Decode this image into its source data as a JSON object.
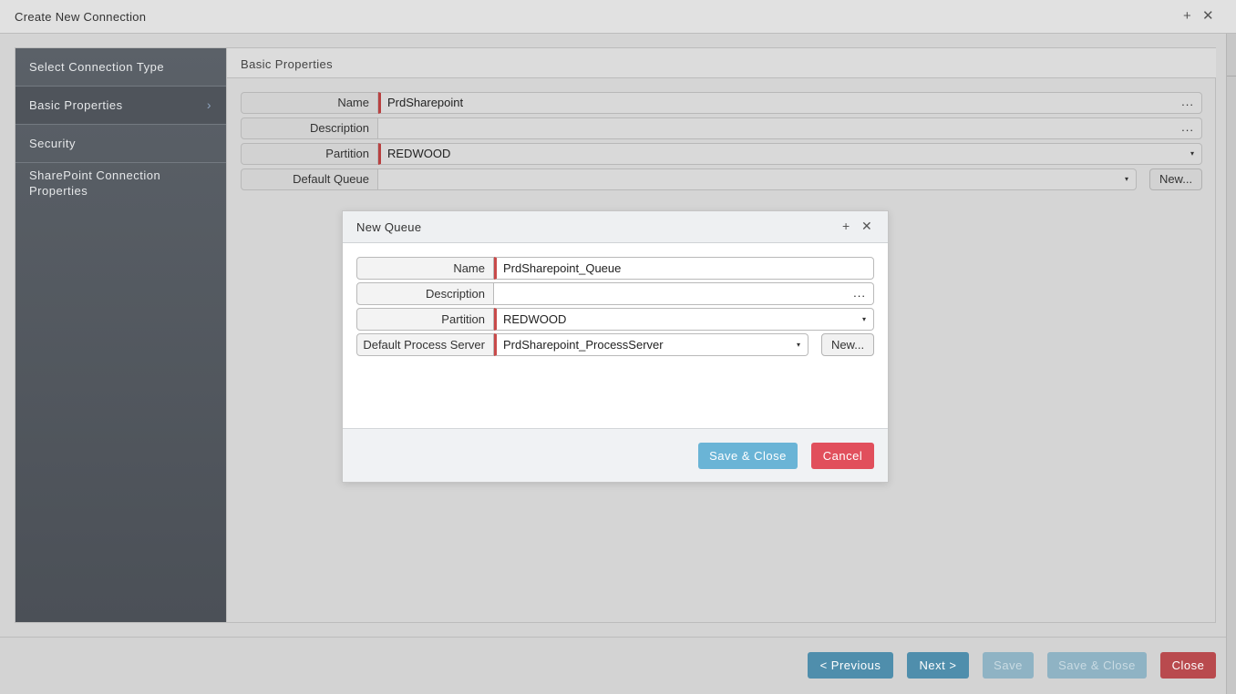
{
  "window": {
    "title": "Create New Connection",
    "maximize_glyph": "+",
    "close_glyph": "✕"
  },
  "sidebar": {
    "items": [
      {
        "label": "Select Connection Type"
      },
      {
        "label": "Basic Properties",
        "active": true,
        "chevron": "›"
      },
      {
        "label": "Security"
      },
      {
        "label": "SharePoint Connection Properties"
      }
    ]
  },
  "content": {
    "title": "Basic Properties",
    "fields": {
      "name": {
        "label": "Name",
        "value": "PrdSharepoint",
        "more": "..."
      },
      "description": {
        "label": "Description",
        "value": "",
        "more": "..."
      },
      "partition": {
        "label": "Partition",
        "value": "REDWOOD",
        "caret": "▾"
      },
      "default_queue": {
        "label": "Default Queue",
        "value": "",
        "caret": "▾",
        "new_label": "New..."
      }
    }
  },
  "footer": {
    "previous": "< Previous",
    "next": "Next >",
    "save": "Save",
    "save_close": "Save & Close",
    "close": "Close"
  },
  "modal": {
    "title": "New Queue",
    "maximize_glyph": "+",
    "close_glyph": "✕",
    "fields": {
      "name": {
        "label": "Name",
        "value": "PrdSharepoint_Queue"
      },
      "description": {
        "label": "Description",
        "value": "",
        "more": "..."
      },
      "partition": {
        "label": "Partition",
        "value": "REDWOOD",
        "caret": "▾"
      },
      "process_server": {
        "label": "Default Process Server",
        "value": "PrdSharepoint_ProcessServer",
        "caret": "▾",
        "new_label": "New..."
      }
    },
    "save_close": "Save & Close",
    "cancel": "Cancel"
  },
  "colors": {
    "sidebar_bg": "#51565d",
    "required_marker": "#b84040",
    "primary_button": "#4f8eac",
    "danger_button": "#b94a4e",
    "modal_save": "#6ab4d6",
    "modal_cancel": "#e14f5c"
  }
}
